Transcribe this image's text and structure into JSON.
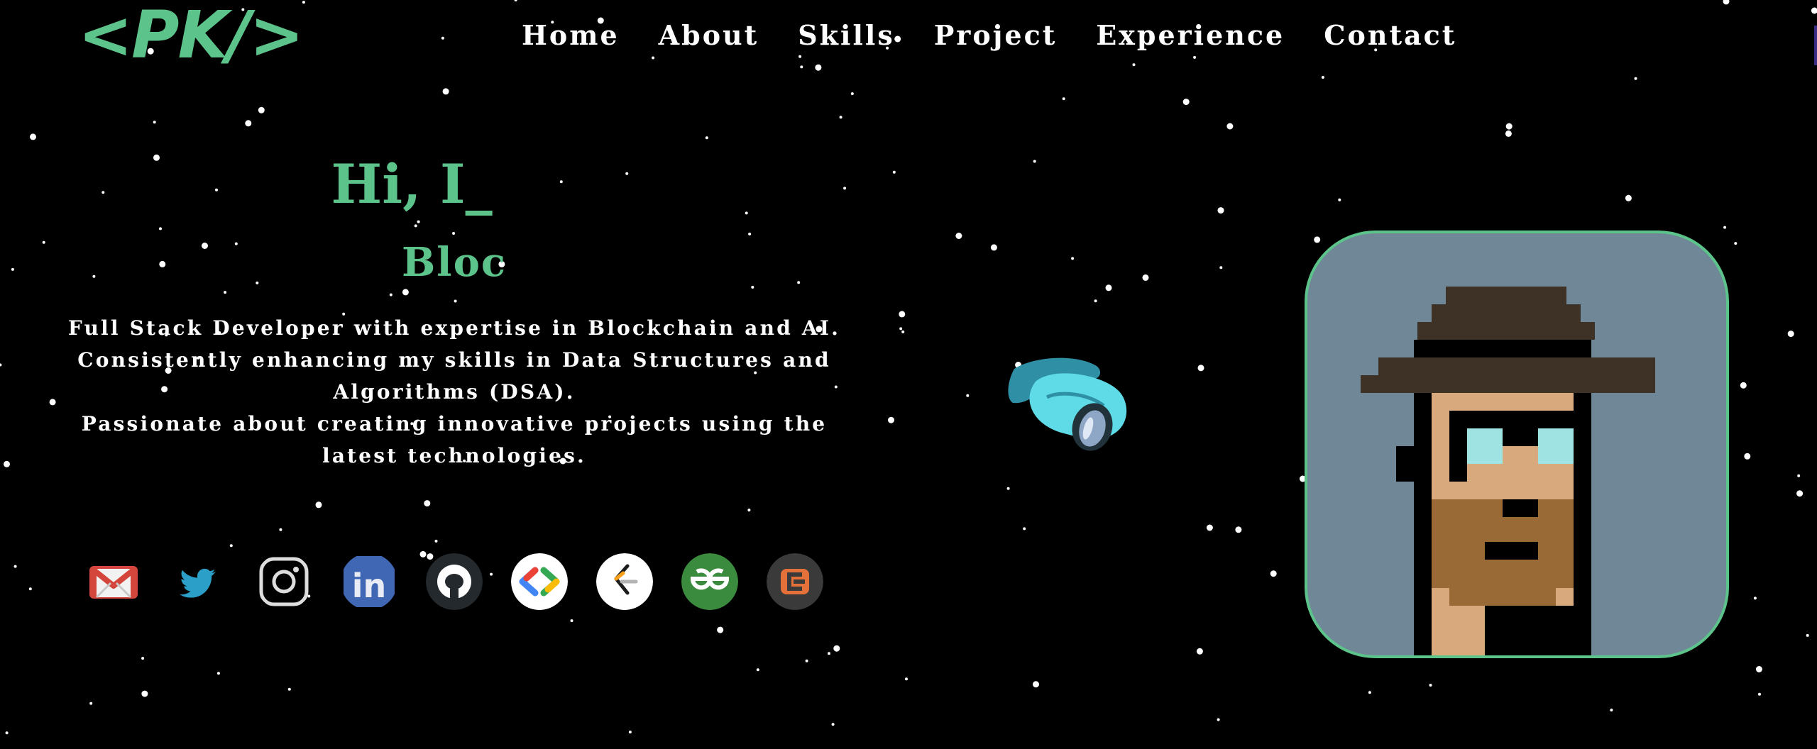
{
  "logo": "<PK/>",
  "nav": {
    "items": [
      "Home",
      "About",
      "Skills",
      "Project",
      "Experience",
      "Contact"
    ]
  },
  "hero": {
    "greeting": "Hi, I_",
    "typed_text": "Bloc",
    "bio": [
      "Full Stack Developer with expertise in Blockchain and AI.",
      "Consistently enhancing my skills in Data Structures and Algorithms (DSA).",
      "Passionate about creating innovative projects using the latest technologies."
    ]
  },
  "socials": [
    {
      "icon": "gmail-icon"
    },
    {
      "icon": "twitter-icon"
    },
    {
      "icon": "instagram-icon"
    },
    {
      "icon": "linkedin-icon"
    },
    {
      "icon": "github-icon"
    },
    {
      "icon": "code-brackets-icon"
    },
    {
      "icon": "leetcode-icon"
    },
    {
      "icon": "geeksforgeeks-icon"
    },
    {
      "icon": "codechef-icon"
    }
  ],
  "colors": {
    "accent": "#5cc38b",
    "background": "#000000",
    "avatar_bg": "#6f8797"
  }
}
